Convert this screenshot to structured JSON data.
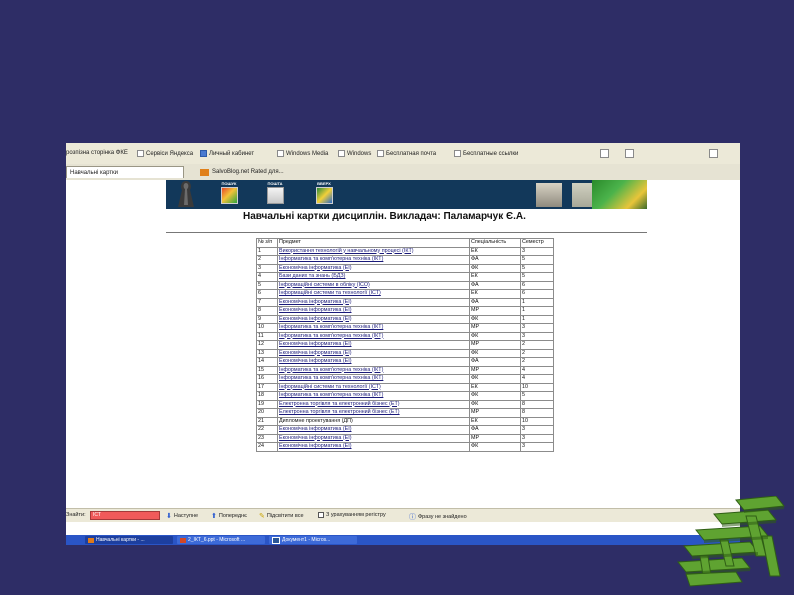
{
  "favorites": [
    {
      "label": "розпізна сторінка ФКЕ"
    },
    {
      "label": "Сервіси Яндекса"
    },
    {
      "label": "Личный кабинет"
    },
    {
      "label": "Windows Media"
    },
    {
      "label": "Windows"
    },
    {
      "label": "Бесплатная почта"
    },
    {
      "label": "Бесплатные ссылки"
    }
  ],
  "tabs": [
    {
      "label": "Навчальні картки"
    },
    {
      "label": "SalvoBlog.net Rated для..."
    }
  ],
  "banner_nav": [
    {
      "label": "ПОШУК"
    },
    {
      "label": "ПОШТА"
    },
    {
      "label": "ВВЕРХ"
    }
  ],
  "page_title": "Навчальні картки дисциплін. Викладач: Паламарчук Є.А.",
  "table": {
    "headers": [
      "№ з/п",
      "Предмет",
      "Спеціальність",
      "Семестр"
    ],
    "rows": [
      [
        "1",
        "Використання технологій у навчальному процесі (ІКТ)",
        "ЕК",
        "3"
      ],
      [
        "2",
        "Інформатика та комп'ютерна техніка (ІКТ)",
        "ФА",
        "5"
      ],
      [
        "3",
        "Економічна інформатика (ЕІ)",
        "ФК",
        "5"
      ],
      [
        "4",
        "Бази даних та знань (БДЗ)",
        "ЕК",
        "5"
      ],
      [
        "5",
        "Інформаційні системи в обліку (ІСО)",
        "ФА",
        "6"
      ],
      [
        "6",
        "Інформаційні системи та технології (ІСТ)",
        "ЕК",
        "6"
      ],
      [
        "7",
        "Економічна інформатика (ЕІ)",
        "ФА",
        "1"
      ],
      [
        "8",
        "Економічна інформатика (ЕІ)",
        "МР",
        "1"
      ],
      [
        "9",
        "Економічна інформатика (ЕІ)",
        "ФК",
        "1"
      ],
      [
        "10",
        "Інформатика та комп'ютерна техніка (ІКТ)",
        "МР",
        "3"
      ],
      [
        "11",
        "Інформатика та комп'ютерна техніка (ІКТ)",
        "ФК",
        "3"
      ],
      [
        "12",
        "Економічна інформатика (ЕІ)",
        "МР",
        "2"
      ],
      [
        "13",
        "Економічна інформатика (ЕІ)",
        "ФК",
        "2"
      ],
      [
        "14",
        "Економічна інформатика (ЕІ)",
        "ФА",
        "2"
      ],
      [
        "15",
        "Інформатика та комп'ютерна техніка (ІКТ)",
        "МР",
        "4"
      ],
      [
        "16",
        "Інформатика та комп'ютерна техніка (ІКТ)",
        "ФК",
        "4"
      ],
      [
        "17",
        "Інформаційні системи та технології (ІСТ)",
        "ЕК",
        "10"
      ],
      [
        "18",
        "Інформатика та комп'ютерна техніка (ІКТ)",
        "ФК",
        "5"
      ],
      [
        "19",
        "Електронна торгівля та електронний бізнес (ЕТ)",
        "ФК",
        "8"
      ],
      [
        "20",
        "Електронна торгівля та електронний бізнес (ЕТ)",
        "МР",
        "8"
      ],
      [
        "21",
        "Дипломне проектування (ДП)",
        "ЕК",
        "10"
      ],
      [
        "22",
        "Економічна інформатика (ЕІ)",
        "ФА",
        "3"
      ],
      [
        "23",
        "Економічна інформатика (ЕІ)",
        "МР",
        "3"
      ],
      [
        "24",
        "Економічна інформатика (ЕІ)",
        "ФК",
        "3"
      ]
    ]
  },
  "findbar": {
    "label": "Знайти:",
    "value": "ІСТ",
    "next": "Наступне",
    "prev": "Попереднє",
    "highlight": "Підсвітити все",
    "match_case": "З урахуванням регістру",
    "status": "Фразу не знайдено"
  },
  "taskbar": [
    {
      "label": "Навчальні картки - ..."
    },
    {
      "label": "2_ІКТ_6.ppt - Microsoft ..."
    },
    {
      "label": "Документ1 - Micros..."
    }
  ]
}
